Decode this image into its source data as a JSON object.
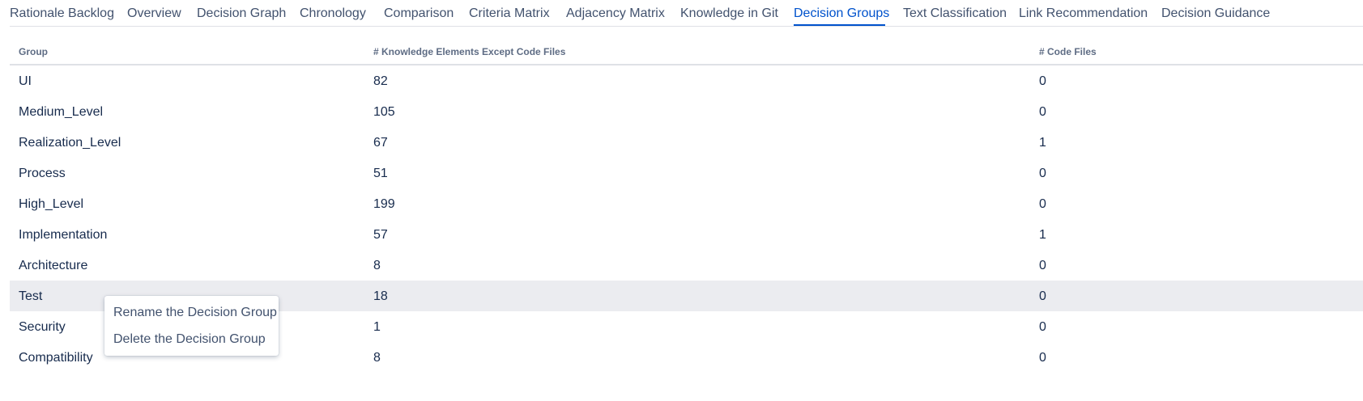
{
  "tabs": [
    {
      "label": "Rationale Backlog",
      "active": false
    },
    {
      "label": "Overview",
      "active": false
    },
    {
      "label": "Decision Graph",
      "active": false
    },
    {
      "label": "Chronology",
      "active": false
    },
    {
      "label": "Comparison",
      "active": false
    },
    {
      "label": "Criteria Matrix",
      "active": false
    },
    {
      "label": "Adjacency Matrix",
      "active": false
    },
    {
      "label": "Knowledge in Git",
      "active": false
    },
    {
      "label": "Decision Groups",
      "active": true
    },
    {
      "label": "Text Classification",
      "active": false
    },
    {
      "label": "Link Recommendation",
      "active": false
    },
    {
      "label": "Decision Guidance",
      "active": false
    }
  ],
  "table": {
    "headers": [
      "Group",
      "# Knowledge Elements Except Code Files",
      "# Code Files"
    ],
    "rows": [
      [
        "UI",
        "82",
        "0"
      ],
      [
        "Medium_Level",
        "105",
        "0"
      ],
      [
        "Realization_Level",
        "67",
        "1"
      ],
      [
        "Process",
        "51",
        "0"
      ],
      [
        "High_Level",
        "199",
        "0"
      ],
      [
        "Implementation",
        "57",
        "1"
      ],
      [
        "Architecture",
        "8",
        "0"
      ],
      [
        "Test",
        "18",
        "0"
      ],
      [
        "Security",
        "1",
        "0"
      ],
      [
        "Compatibility",
        "8",
        "0"
      ]
    ]
  },
  "context_menu": {
    "items": [
      "Rename the Decision Group",
      "Delete the Decision Group"
    ]
  },
  "colors": {
    "accent": "#0052cc",
    "text": "#172b4d",
    "tab_text": "#42526e",
    "hover_row": "#ebecf0"
  }
}
